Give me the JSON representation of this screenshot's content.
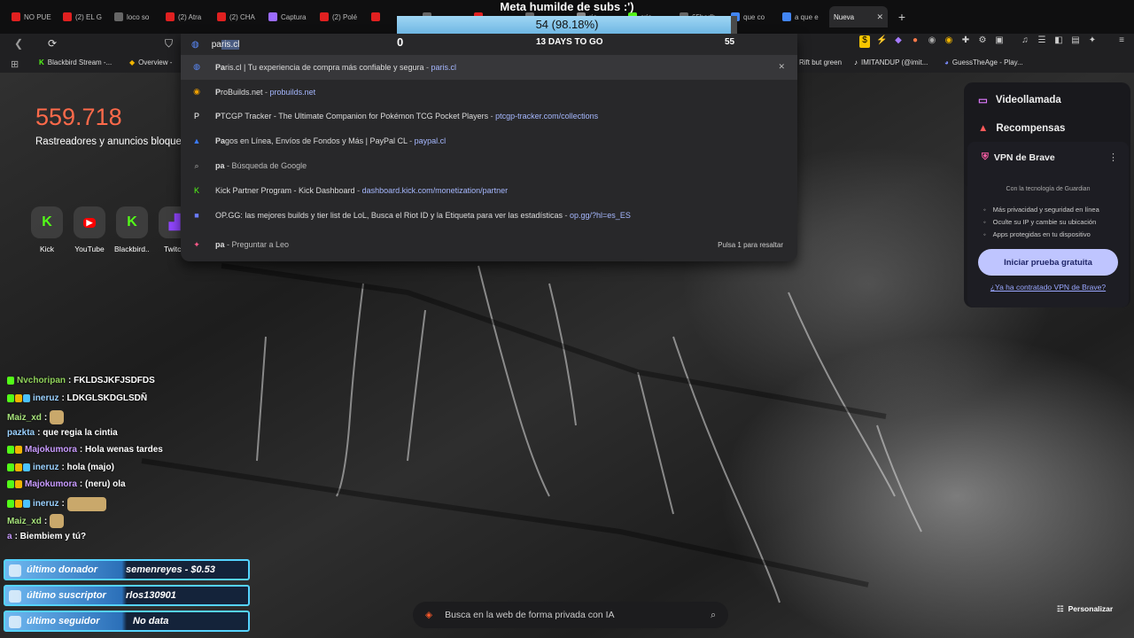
{
  "overlay": {
    "title": "Meta humilde de subs :')",
    "progress_text": "54 (98.18%)",
    "progress_fraction": 0.9818,
    "start": "0",
    "end": "55",
    "days": "13 DAYS TO GO"
  },
  "tabs": [
    {
      "label": "NO PUE",
      "icon": "youtube-icon",
      "color": "#e02020"
    },
    {
      "label": "(2) EL G",
      "icon": "youtube-icon",
      "color": "#e02020"
    },
    {
      "label": "loco so",
      "icon": "page-icon",
      "color": "#666666"
    },
    {
      "label": "(2) Atra",
      "icon": "youtube-icon",
      "color": "#e02020"
    },
    {
      "label": "(2) CHA",
      "icon": "youtube-icon",
      "color": "#e02020"
    },
    {
      "label": "Captura",
      "icon": "pen-icon",
      "color": "#9b6bff"
    },
    {
      "label": "(2) Polé",
      "icon": "youtube-icon",
      "color": "#e02020"
    },
    {
      "label": "",
      "icon": "youtube-icon",
      "color": "#e02020"
    },
    {
      "label": "",
      "icon": "page-icon",
      "color": "#666666"
    },
    {
      "label": "",
      "icon": "youtube-icon",
      "color": "#e02020"
    },
    {
      "label": "",
      "icon": "page-icon",
      "color": "#666666"
    },
    {
      "label": "rie",
      "icon": "search-icon",
      "color": "#888888"
    },
    {
      "label": "cris",
      "icon": "kick-icon",
      "color": "#53fc18"
    },
    {
      "label": "65bedb",
      "icon": "page-icon",
      "color": "#666666"
    },
    {
      "label": "que co",
      "icon": "google-icon",
      "color": "#4285f4"
    },
    {
      "label": "a que e",
      "icon": "google-icon",
      "color": "#4285f4"
    },
    {
      "label": "Nueva",
      "icon": "",
      "color": "#2a2a2c",
      "active": true
    }
  ],
  "omnibox": {
    "typed": "pa",
    "autocomplete": "ris.cl",
    "suggestions": [
      {
        "icon": "brave-icon",
        "bold": "Pa",
        "rest": "ris.cl | Tu experiencia de compra más confiable y segura",
        "sep": " - ",
        "url": "paris.cl",
        "highlighted": true
      },
      {
        "icon": "probuilds-icon",
        "bold": "P",
        "rest": "roBuilds.net",
        "sep": " - ",
        "url": "probuilds.net"
      },
      {
        "icon": "ptcgp-icon",
        "bold": "P",
        "rest": "TCGP Tracker - The Ultimate Companion for Pokémon TCG Pocket Players",
        "sep": " - ",
        "url": "ptcgp-tracker.com/collections"
      },
      {
        "icon": "paypal-icon",
        "bold": "Pa",
        "rest": "gos en Línea, Envíos de Fondos y Más | PayPal CL",
        "sep": " - ",
        "url": "paypal.cl"
      },
      {
        "icon": "search-icon",
        "bold": "pa",
        "rest": "",
        "sep": " - ",
        "url": "Búsqueda de Google",
        "dim": true
      },
      {
        "icon": "kick-icon",
        "bold": "",
        "rest": "Kick Partner Program - Kick Dashboard",
        "sep": " - ",
        "url": "dashboard.kick.com/monetization/partner"
      },
      {
        "icon": "opgg-icon",
        "bold": "",
        "rest": "OP.GG: las mejores builds y tier list de LoL, Busca el Riot ID y la Etiqueta para ver las estadísticas",
        "sep": " - ",
        "url": "op.gg/?hl=es_ES"
      },
      {
        "icon": "leo-icon",
        "bold": "pa",
        "rest": "",
        "sep": " - ",
        "url": "Preguntar a Leo",
        "dim": true,
        "hint": "Pulsa 1 para resaltar",
        "leo": true
      }
    ]
  },
  "bookmarks": [
    {
      "icon": "kick-icon",
      "label": "Blackbird Stream -..."
    },
    {
      "icon": "overview-icon",
      "label": "Overview -"
    },
    {
      "icon": "",
      "label": "Rift but green"
    },
    {
      "icon": "tiktok-icon",
      "label": "IMITANDUP (@imit..."
    },
    {
      "icon": "guess-icon",
      "label": "GuessTheAge - Play..."
    }
  ],
  "newtab": {
    "count": "559.718",
    "count_label": "Rastreadores y anuncios bloqueados",
    "shortcuts": [
      {
        "label": "Kick",
        "icon": "kick-icon"
      },
      {
        "label": "YouTube",
        "icon": "youtube-icon"
      },
      {
        "label": "Blackbird...",
        "icon": "kick-icon"
      },
      {
        "label": "Twitch",
        "icon": "twitch-icon"
      }
    ]
  },
  "rightpanel": {
    "videocall": "Videollamada",
    "rewards": "Recompensas",
    "vpn": {
      "title": "VPN de Brave",
      "powered": "Con la tecnología de  Guardian",
      "features": [
        "Más privacidad y seguridad en línea",
        "Oculte su IP y cambie su ubicación",
        "Apps protegidas en tu dispositivo"
      ],
      "button": "Iniciar prueba gratuita",
      "link": "¿Ya ha contratado VPN de Brave?"
    }
  },
  "chat": [
    {
      "user": "Nvchoripan",
      "text": ": FKLDSJKFJSDFDS",
      "color": "#8fd15a",
      "badges": 1
    },
    {
      "user": "ineruz",
      "text": ": LDKGLSKDGLSDÑ",
      "color": "#9ad1ff",
      "badges": 3
    },
    {
      "user": "Maiz_xd",
      "text": ":",
      "color": "#a6e27a",
      "badges": 0,
      "emote": true
    },
    {
      "user": "pazkta",
      "text": ": que regia la cintia",
      "color": "#9ad1ff",
      "badges": 0
    },
    {
      "user": "Majokumora",
      "text": ": Hola wenas tardes",
      "color": "#c99bff",
      "badges": 2
    },
    {
      "user": "ineruz",
      "text": ": hola (majo)",
      "color": "#9ad1ff",
      "badges": 3
    },
    {
      "user": "Majokumora",
      "text": ": (neru) ola",
      "color": "#c99bff",
      "badges": 2
    },
    {
      "user": "ineruz",
      "text": ":",
      "color": "#9ad1ff",
      "badges": 3,
      "emote": true
    },
    {
      "user": "Maiz_xd",
      "text": ":",
      "color": "#a6e27a",
      "badges": 0,
      "emote": true
    },
    {
      "user": "a",
      "text": ": Biembiem y tú?",
      "color": "#c99bff",
      "badges": 0
    }
  ],
  "widgets": [
    {
      "label": "último donador",
      "value": "semenreyes - $0.53"
    },
    {
      "label": "último suscriptor",
      "value": "rlos130901"
    },
    {
      "label": "último seguidor",
      "value": "No data"
    }
  ],
  "search_ai": "Busca en la web de forma privada con IA",
  "customize": "Personalizar"
}
